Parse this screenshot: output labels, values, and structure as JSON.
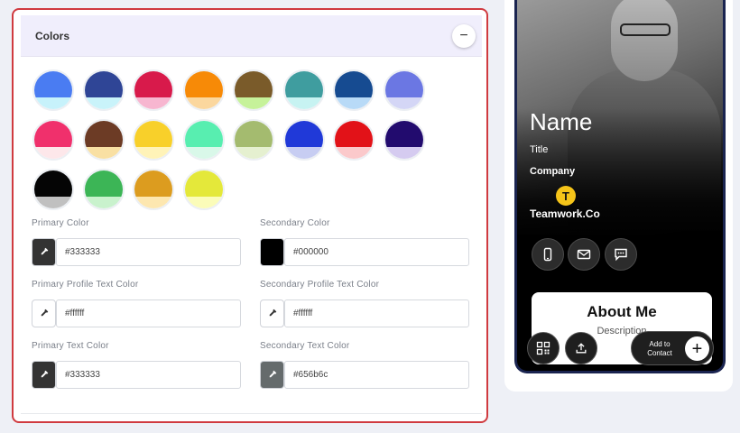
{
  "colors_section": {
    "title": "Colors",
    "collapse_symbol": "−"
  },
  "swatches": [
    {
      "top": "#4a7cf2",
      "bottom": "#c7f2fb"
    },
    {
      "top": "#2f4596",
      "bottom": "#c9f3fa"
    },
    {
      "top": "#d81a4b",
      "bottom": "#f7b6d0"
    },
    {
      "top": "#f78a07",
      "bottom": "#fbd79e"
    },
    {
      "top": "#7a5b2a",
      "bottom": "#c6f29a"
    },
    {
      "top": "#3f9d9f",
      "bottom": "#c7f3f2"
    },
    {
      "top": "#164b91",
      "bottom": "#b8daf7"
    },
    {
      "top": "#6b77e3",
      "bottom": "#d4d6f6"
    },
    {
      "top": "#f0306c",
      "bottom": "#fde7ea"
    },
    {
      "top": "#6c3b25",
      "bottom": "#f9e0a3"
    },
    {
      "top": "#f8d02a",
      "bottom": "#fff3b8"
    },
    {
      "top": "#58eeb0",
      "bottom": "#d9f8e9"
    },
    {
      "top": "#a4bb6f",
      "bottom": "#e5f0d0"
    },
    {
      "top": "#2039d8",
      "bottom": "#c7cdf2"
    },
    {
      "top": "#e21218",
      "bottom": "#fbc9cb"
    },
    {
      "top": "#220b6e",
      "bottom": "#d5cbf0"
    },
    {
      "top": "#050505",
      "bottom": "#c0c0c0"
    },
    {
      "top": "#3cb556",
      "bottom": "#c9f2cd"
    },
    {
      "top": "#dc9c1f",
      "bottom": "#fde7b0"
    },
    {
      "top": "#e4e83a",
      "bottom": "#fbfcb9"
    }
  ],
  "fields": {
    "primary_color": {
      "label": "Primary Color",
      "value": "#333333",
      "swatch": "#333333"
    },
    "secondary_color": {
      "label": "Secondary Color",
      "value": "#000000",
      "swatch": "#000000"
    },
    "primary_profile_text_color": {
      "label": "Primary Profile Text Color",
      "value": "#ffffff",
      "swatch": "#ffffff"
    },
    "secondary_profile_text_color": {
      "label": "Secondary Profile Text Color",
      "value": "#ffffff",
      "swatch": "#ffffff"
    },
    "primary_text_color": {
      "label": "Primary Text Color",
      "value": "#333333",
      "swatch": "#333333"
    },
    "secondary_text_color": {
      "label": "Secondary Text Color",
      "value": "#656b6c",
      "swatch": "#656b6c"
    }
  },
  "preview": {
    "name": "Name",
    "title": "Title",
    "company": "Company",
    "logo_letter": "T",
    "brand": "Teamwork.Co",
    "about_title": "About Me",
    "about_description": "Description",
    "add_to_contact_line1": "Add to",
    "add_to_contact_line2": "Contact",
    "add_plus": "+"
  }
}
